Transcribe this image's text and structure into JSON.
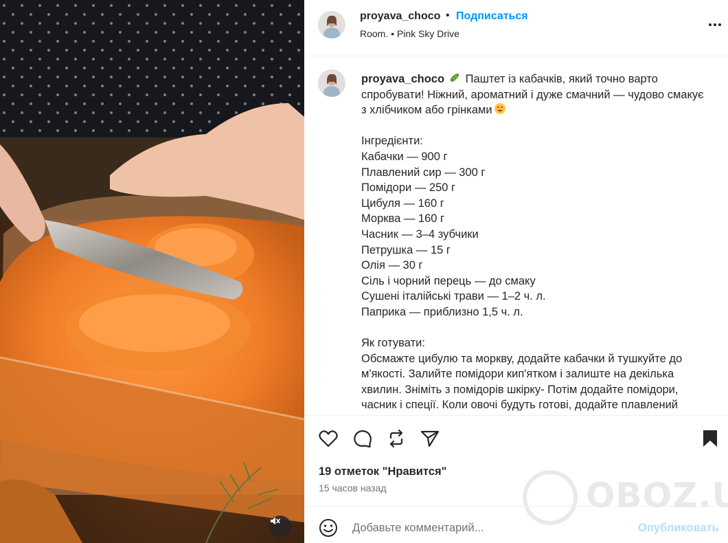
{
  "colors": {
    "accent": "#0095f6",
    "text": "#262626",
    "muted": "#737373",
    "post_disabled": "#b2dffc",
    "divider": "#efefef"
  },
  "media": {
    "mute_icon": "speaker-muted-icon"
  },
  "header": {
    "username": "proyava_choco",
    "separator": "•",
    "follow_label": "Подписаться",
    "location": "Room. • Pink Sky Drive",
    "more_icon": "more-options-icon"
  },
  "caption": {
    "username": "proyava_choco",
    "intro_emoji": "cucumber-emoji",
    "intro": "Паштет із кабачків, який точно варто спробувати! Ніжний, ароматний і дуже смачний — чудово смакує з хлібчиком або грінками",
    "intro_end_emoji": "smiling-face-with-heart-eyes-emoji",
    "ingredients_title": "Інгредієнти:",
    "ingredients": [
      "Кабачки — 900 г",
      "Плавлений сир — 300 г",
      "Помідори — 250 г",
      "Цибуля — 160 г",
      "Морква — 160 г",
      "Часник — 3–4 зубчики",
      "Петрушка — 15 г",
      "Олія — 30 г",
      "Сіль і чорний перець — до смаку",
      "Сушені італійські трави — 1–2 ч. л.",
      "Паприка — приблизно 1,5 ч. л."
    ],
    "method_title": "Як готувати:",
    "method": "Обсмажте цибулю та моркву, додайте кабачки й тушкуйте до м'якості. Залийте помідори кип'ятком і залиште на декілька хвилин. Зніміть з помідорів шкірку- Потім додайте помідори, часник і спеції. Коли овочі будуть готові, додайте плавлений"
  },
  "actions": {
    "like_icon": "heart-icon",
    "comment_icon": "comment-icon",
    "repost_icon": "repost-icon",
    "share_icon": "send-icon",
    "save_icon": "bookmark-icon",
    "likes": "19 отметок \"Нравится\"",
    "time": "15 часов назад"
  },
  "watermark": {
    "text": "OBOZ.UA"
  },
  "comment": {
    "emoji_icon": "emoji-smile-icon",
    "placeholder": "Добавьте комментарий...",
    "value": "",
    "post_label": "Опубликовать"
  }
}
